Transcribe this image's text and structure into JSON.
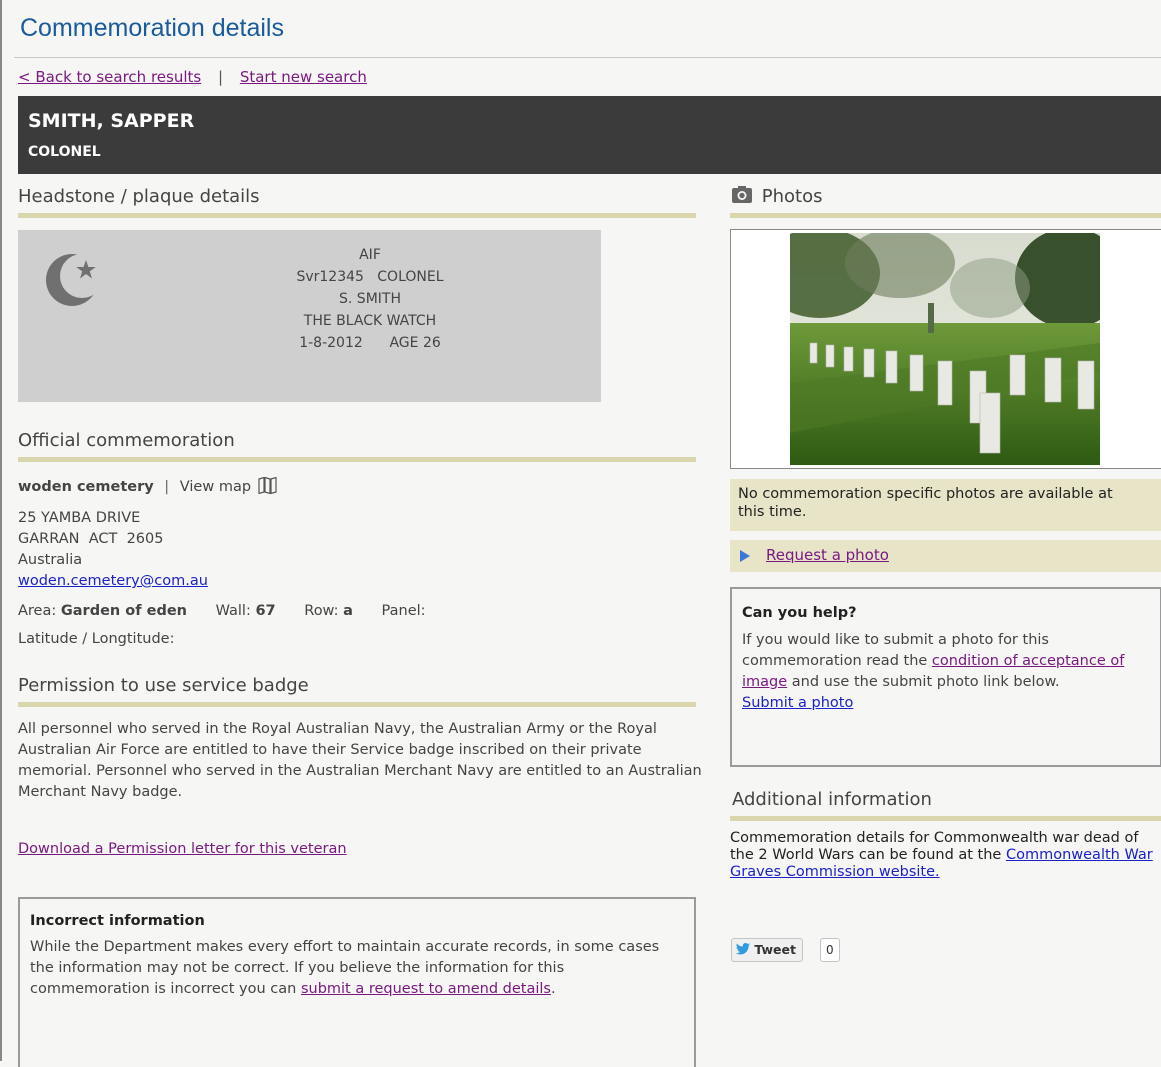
{
  "page": {
    "title": "Commemoration details"
  },
  "nav": {
    "back": "< Back to search results",
    "sep": "|",
    "new_search": "Start new search"
  },
  "banner": {
    "name": "SMITH, SAPPER",
    "rank": "COLONEL"
  },
  "headstone": {
    "heading": "Headstone / plaque details",
    "lines": [
      "AIF",
      "Svr12345   COLONEL",
      "S. SMITH",
      "THE BLACK WATCH",
      "1-8-2012      AGE 26"
    ]
  },
  "official": {
    "heading": "Official commemoration",
    "cemetery": "woden cemetery",
    "sep": "|",
    "view_map": "View map",
    "address": [
      "25 YAMBA DRIVE",
      "GARRAN  ACT  2605",
      "Australia"
    ],
    "email": "woden.cemetery@com.au",
    "area_label": "Area:",
    "area_value": "Garden of eden",
    "wall_label": "Wall:",
    "wall_value": "67",
    "row_label": "Row:",
    "row_value": "a",
    "panel_label": "Panel:",
    "latlong_label": "Latitude / Longtitude:"
  },
  "badge": {
    "heading": "Permission to use service badge",
    "text": "All personnel who served in the Royal Australian Navy, the Australian Army or the Royal Australian Air Force are entitled to have their Service badge inscribed on their private memorial. Personnel who served in the Australian Merchant Navy are entitled to an Australian Merchant Navy badge.",
    "download": "Download a Permission letter for this veteran"
  },
  "incorrect": {
    "title": "Incorrect information",
    "text": "While the Department makes every effort to maintain accurate records, in some cases the information may not be correct. If you believe the information for this commemoration is incorrect you can ",
    "link": "submit a request to amend details",
    "end": "."
  },
  "photos": {
    "heading": "Photos",
    "none_text": "No commemoration specific photos are available at this time.",
    "request": "Request a photo"
  },
  "help": {
    "title": "Can you help?",
    "text_before": "If you would like to submit a photo for this commemoration read the ",
    "link": "condition of acceptance of image",
    "text_after": " and use the submit photo link below.",
    "submit": "Submit a photo"
  },
  "additional": {
    "heading": "Additional information",
    "text": "Commemoration details for Commonwealth war dead of the 2 World Wars can be found at the ",
    "link": "Commonwealth War Graves Commission website."
  },
  "tweet": {
    "label": "Tweet",
    "count": "0"
  },
  "colors": {
    "title_blue": "#1a5b9c",
    "banner": "#3b3b3b",
    "accent_rule": "#d9d5ad",
    "link_purple": "#7a1a80",
    "link_blue": "#1a22c8"
  }
}
